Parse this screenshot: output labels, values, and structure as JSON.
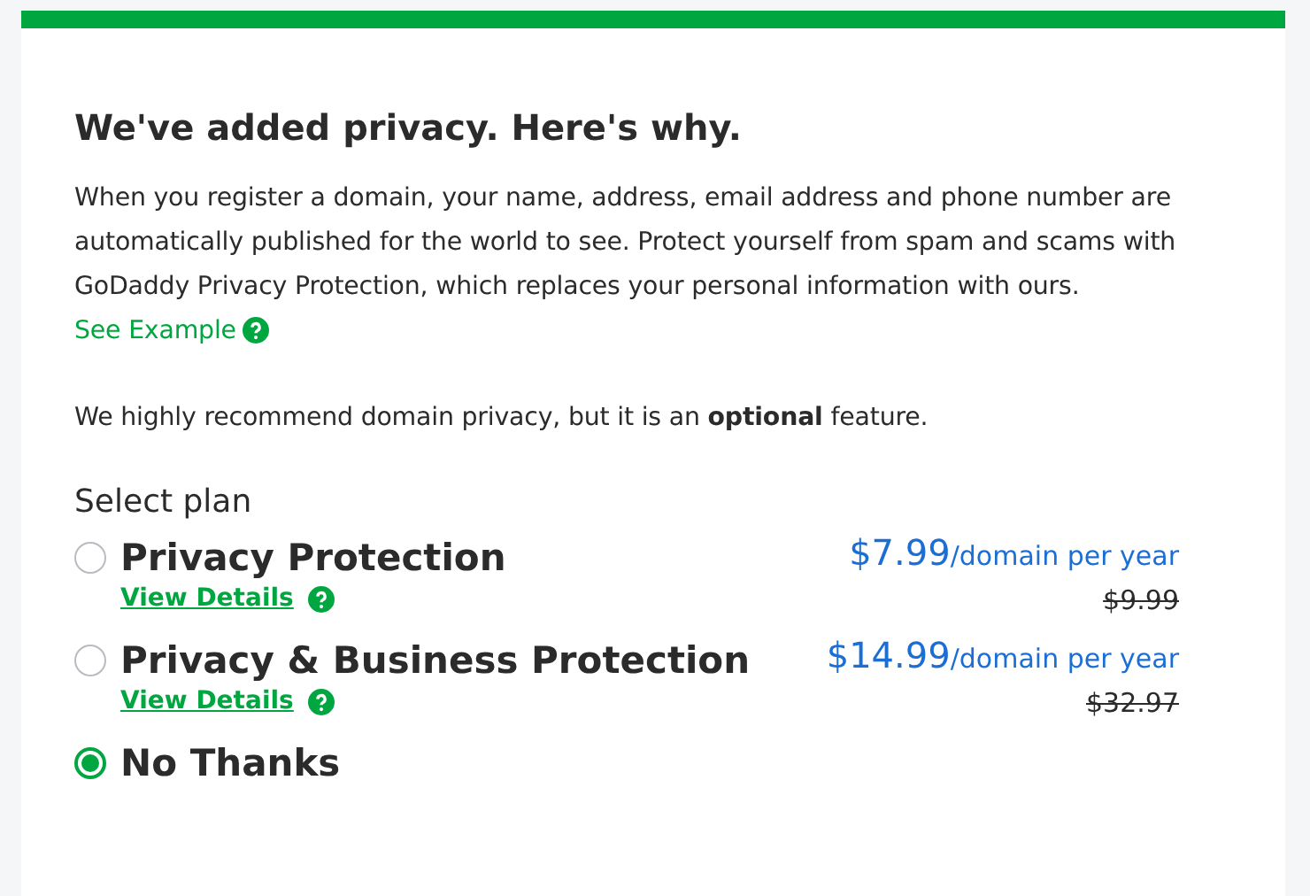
{
  "title": "We've added privacy. Here's why.",
  "intro": {
    "text": "When you register a domain, your name, address, email address and phone number are automatically published for the world to see. Protect yourself from spam and scams with GoDaddy Privacy Protection, which replaces your personal information with ours.",
    "link": "See Example"
  },
  "note": "We highly recommend domain privacy, but it is an **optional** feature.",
  "plan_heading": "Select plan",
  "plans": [
    {
      "name": "Privacy Protection",
      "selected": false,
      "details": "View Details",
      "price": "$7.99",
      "unit": "/domain per year",
      "old_price": "$9.99"
    },
    {
      "name": "Privacy & Business Protection",
      "selected": false,
      "details": "View Details",
      "price": "$14.99",
      "unit": "/domain per year",
      "old_price": "$32.97"
    },
    {
      "name": "No Thanks",
      "selected": true
    }
  ]
}
